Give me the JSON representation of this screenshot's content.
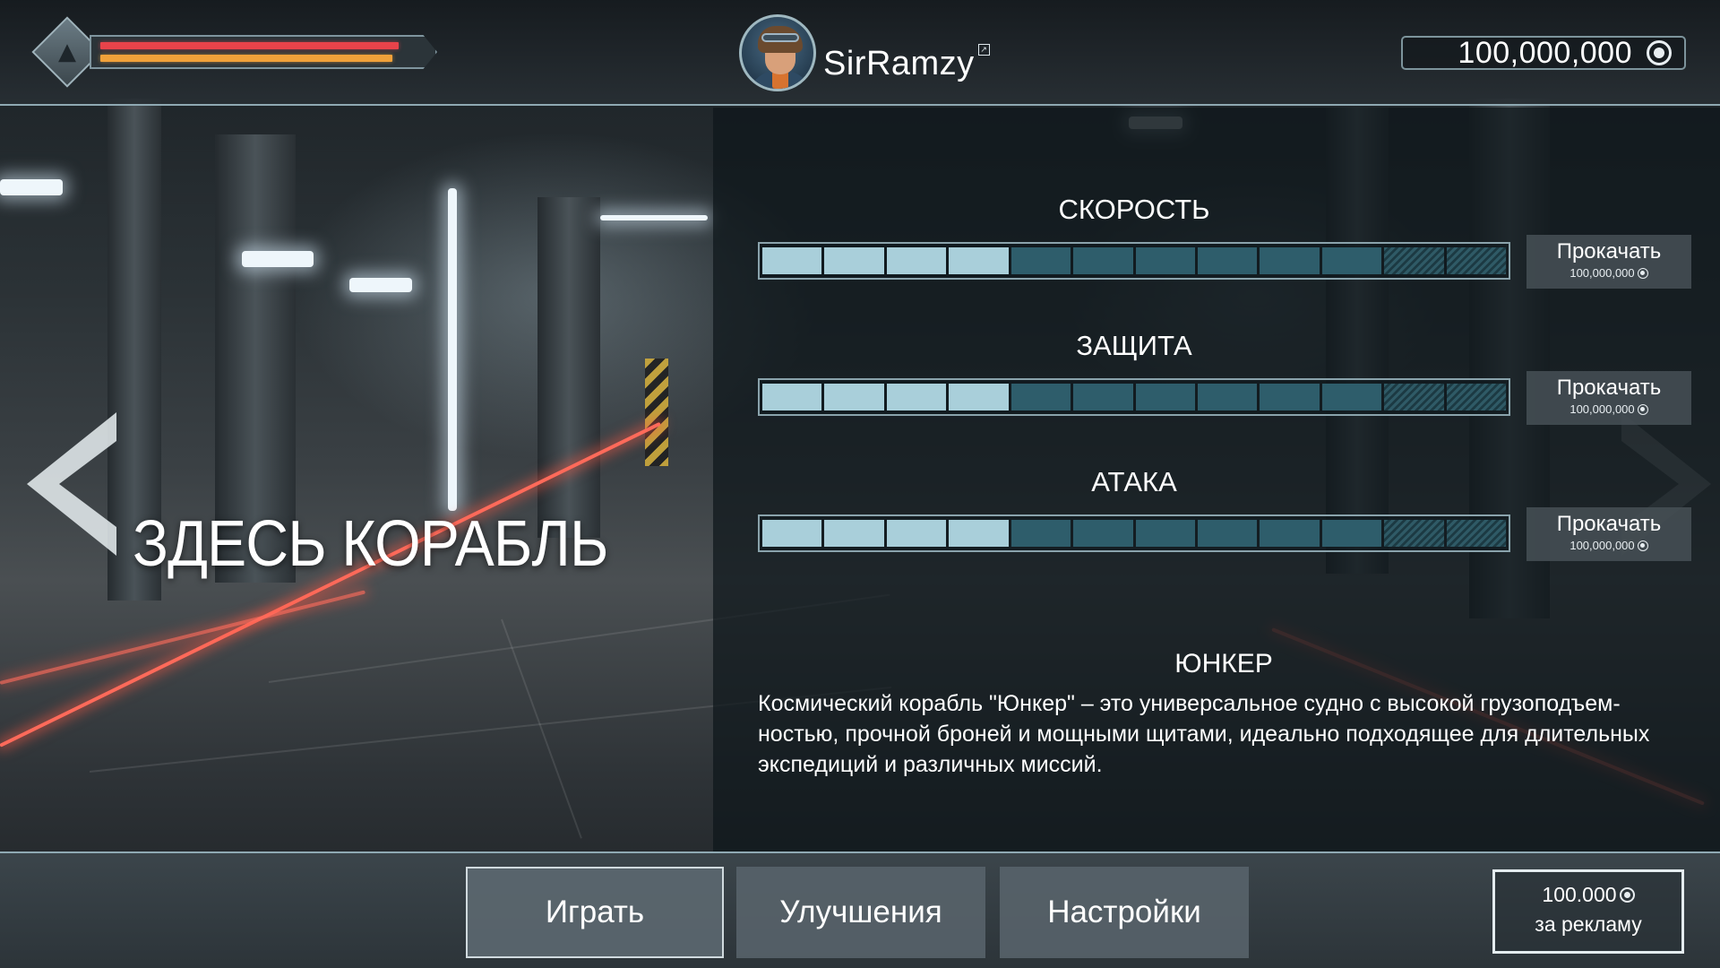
{
  "header": {
    "player_name": "SirRamzy",
    "currency_value": "100,000,000",
    "health_fraction": 0.95,
    "energy_fraction": 0.93,
    "colors": {
      "health": "#e8434a",
      "energy": "#f0a13a",
      "accent": "#8fa9b3"
    }
  },
  "ship": {
    "placeholder": "ЗДЕСЬ КОРАБЛЬ",
    "name": "ЮНКЕР",
    "description_lines": [
      "Космический корабль \"Юнкер\" – это универсальное судно с высокой грузоподъем-",
      "ностью, прочной броней и мощными щитами, идеально подходящее для длительных",
      "экспедиций и различных миссий."
    ]
  },
  "stats": [
    {
      "title": "СКОРОСТЬ",
      "filled": 4,
      "available": 6,
      "locked": 2,
      "upgrade_label": "Прокачать",
      "upgrade_cost": "100,000,000"
    },
    {
      "title": "ЗАЩИТА",
      "filled": 4,
      "available": 6,
      "locked": 2,
      "upgrade_label": "Прокачать",
      "upgrade_cost": "100,000,000"
    },
    {
      "title": "АТАКА",
      "filled": 4,
      "available": 6,
      "locked": 2,
      "upgrade_label": "Прокачать",
      "upgrade_cost": "100,000,000"
    }
  ],
  "nav": {
    "play": "Играть",
    "upgrades": "Улучшения",
    "settings": "Настройки"
  },
  "ad_reward": {
    "amount": "100.000",
    "label": "за рекламу"
  },
  "icons": {
    "emblem": "ship-emblem-icon",
    "coin": "coin-icon",
    "edit": "edit-icon",
    "prev": "arrow-left-icon",
    "next": "arrow-right-icon"
  }
}
